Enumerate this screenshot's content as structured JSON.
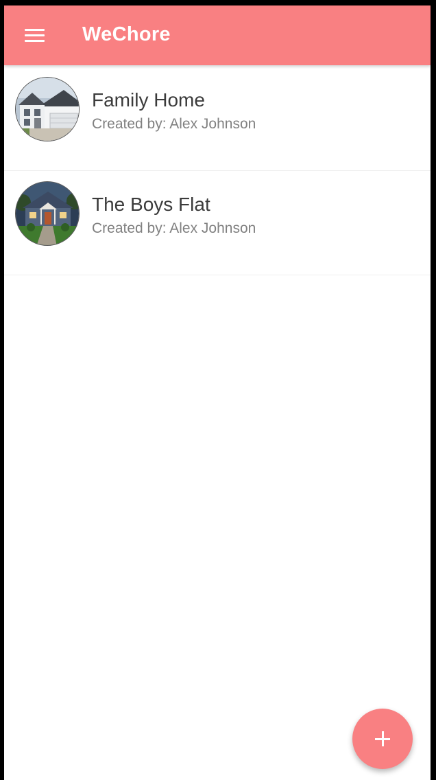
{
  "app": {
    "title": "WeChore",
    "accent_color": "#f98082"
  },
  "appbar": {
    "menu_icon": "hamburger-menu-icon"
  },
  "houses": [
    {
      "name": "Family Home",
      "created_by": "Created by: Alex Johnson",
      "image": "white-house-photo"
    },
    {
      "name": "The Boys Flat",
      "created_by": "Created by: Alex Johnson",
      "image": "blue-house-photo"
    }
  ],
  "fab": {
    "icon": "plus-icon"
  }
}
